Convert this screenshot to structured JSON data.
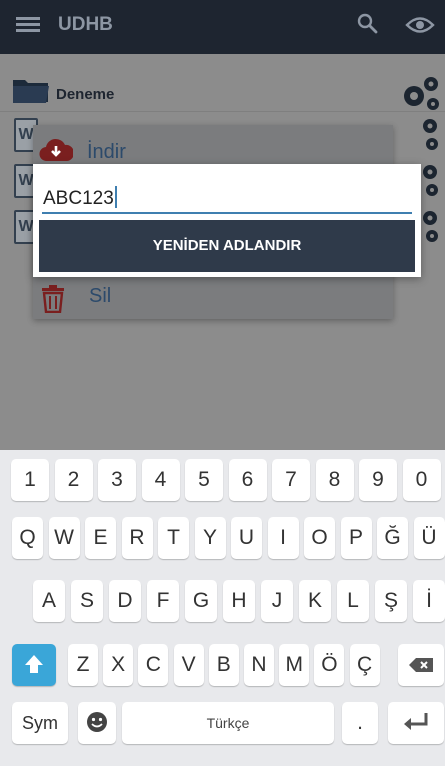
{
  "app_bar": {
    "title": "UDHB",
    "menu_icon": "hamburger-menu-icon",
    "search_icon": "search-icon",
    "eye_icon": "eye-icon"
  },
  "list": {
    "folder_name": "Deneme"
  },
  "context_menu": {
    "download_label": "İndir",
    "delete_label": "Sil"
  },
  "dialog": {
    "input_value": "ABC123",
    "rename_button": "YENİDEN ADLANDIR"
  },
  "keyboard": {
    "row1": [
      "1",
      "2",
      "3",
      "4",
      "5",
      "6",
      "7",
      "8",
      "9",
      "0"
    ],
    "row2": [
      "Q",
      "W",
      "E",
      "R",
      "T",
      "Y",
      "U",
      "I",
      "O",
      "P",
      "Ğ",
      "Ü"
    ],
    "row3": [
      "A",
      "S",
      "D",
      "F",
      "G",
      "H",
      "J",
      "K",
      "L",
      "Ş",
      "İ"
    ],
    "row4": [
      "Z",
      "X",
      "C",
      "V",
      "B",
      "N",
      "M",
      "Ö",
      "Ç"
    ],
    "sym_label": "Sym",
    "space_label": "Türkçe",
    "period_label": "."
  },
  "colors": {
    "app_bar": "#1e2530",
    "button": "#2f3a4a",
    "accent": "#3f7fb0",
    "shift": "#3aa6d8"
  }
}
